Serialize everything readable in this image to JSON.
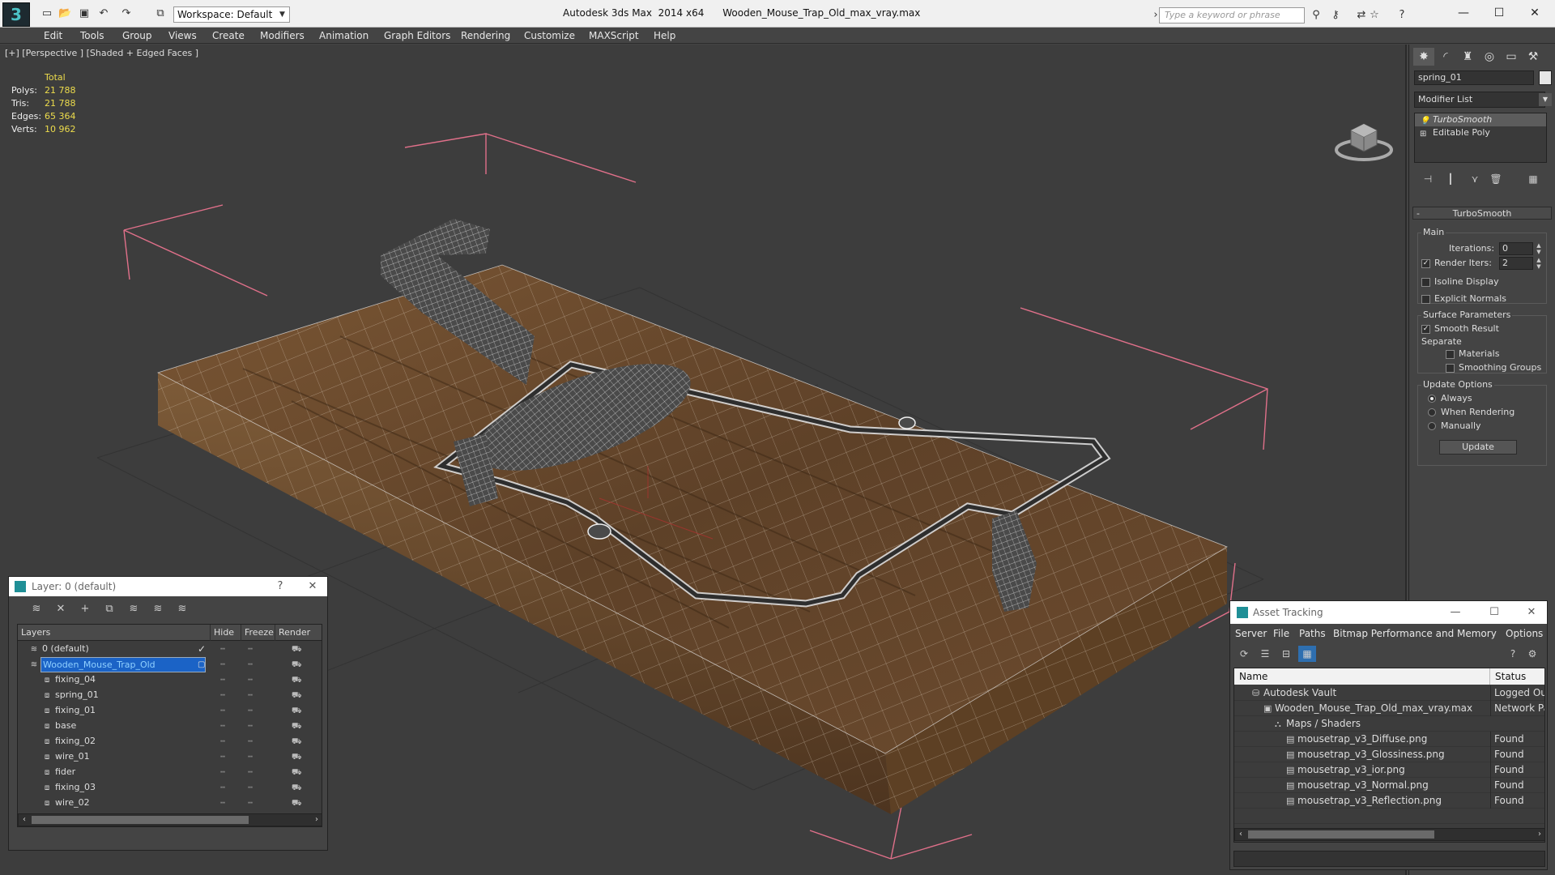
{
  "titlebar": {
    "workspace": "Workspace: Default",
    "title": "Autodesk 3ds Max  2014 x64      Wooden_Mouse_Trap_Old_max_vray.max",
    "search_placeholder": "Type a keyword or phrase"
  },
  "menu": [
    "Edit",
    "Tools",
    "Group",
    "Views",
    "Create",
    "Modifiers",
    "Animation",
    "Graph Editors",
    "Rendering",
    "Customize",
    "MAXScript",
    "Help"
  ],
  "viewport": {
    "label": "[+] [Perspective ] [Shaded + Edged Faces ]",
    "stats": {
      "total_label": "Total",
      "rows": [
        {
          "name": "Polys:",
          "value": "21 788"
        },
        {
          "name": "Tris:",
          "value": "21 788"
        },
        {
          "name": "Edges:",
          "value": "65 364"
        },
        {
          "name": "Verts:",
          "value": "10 962"
        }
      ]
    }
  },
  "command_panel": {
    "object_name": "spring_01",
    "modifier_list": "Modifier List",
    "stack": [
      {
        "label": "TurboSmooth",
        "selected": true
      },
      {
        "label": "Editable Poly",
        "selected": false
      }
    ],
    "rollout": {
      "title": "TurboSmooth",
      "main": {
        "title": "Main",
        "iterations_label": "Iterations:",
        "iterations": "0",
        "render_iters_label": "Render Iters:",
        "render_iters": "2",
        "isoline": "Isoline Display",
        "explicit_normals": "Explicit Normals"
      },
      "surface": {
        "title": "Surface Parameters",
        "smooth_result": "Smooth Result",
        "separate": "Separate",
        "materials": "Materials",
        "smoothing_groups": "Smoothing Groups"
      },
      "update": {
        "title": "Update Options",
        "always": "Always",
        "when_rendering": "When Rendering",
        "manually": "Manually",
        "button": "Update"
      }
    }
  },
  "layer_panel": {
    "title": "Layer: 0 (default)",
    "columns": {
      "layers": "Layers",
      "hide": "Hide",
      "freeze": "Freeze",
      "render": "Render"
    },
    "rows": [
      {
        "name": "0 (default)",
        "level": 0,
        "active": true
      },
      {
        "name": "Wooden_Mouse_Trap_Old",
        "level": 0,
        "selected": true
      },
      {
        "name": "fixing_04",
        "level": 1
      },
      {
        "name": "spring_01",
        "level": 1
      },
      {
        "name": "fixing_01",
        "level": 1
      },
      {
        "name": "base",
        "level": 1
      },
      {
        "name": "fixing_02",
        "level": 1
      },
      {
        "name": "wire_01",
        "level": 1
      },
      {
        "name": "fider",
        "level": 1
      },
      {
        "name": "fixing_03",
        "level": 1
      },
      {
        "name": "wire_02",
        "level": 1
      },
      {
        "name": "Wooden_Mouse_Trap_Old",
        "level": 1
      }
    ]
  },
  "asset_panel": {
    "title": "Asset Tracking",
    "menu": [
      "Server",
      "File",
      "Paths",
      "Bitmap Performance and Memory",
      "Options"
    ],
    "columns": {
      "name": "Name",
      "status": "Status"
    },
    "rows": [
      {
        "name": "Autodesk Vault",
        "level": 0,
        "status": "Logged Out"
      },
      {
        "name": "Wooden_Mouse_Trap_Old_max_vray.max",
        "level": 1,
        "status": "Network Pa"
      },
      {
        "name": "Maps / Shaders",
        "level": 2,
        "status": ""
      },
      {
        "name": "mousetrap_v3_Diffuse.png",
        "level": 3,
        "status": "Found"
      },
      {
        "name": "mousetrap_v3_Glossiness.png",
        "level": 3,
        "status": "Found"
      },
      {
        "name": "mousetrap_v3_ior.png",
        "level": 3,
        "status": "Found"
      },
      {
        "name": "mousetrap_v3_Normal.png",
        "level": 3,
        "status": "Found"
      },
      {
        "name": "mousetrap_v3_Reflection.png",
        "level": 3,
        "status": "Found"
      }
    ]
  },
  "colors": {
    "viewport_bg": "#3d3d3d",
    "stat_value": "#eddc4c",
    "selection": "#1b63c6",
    "wood": "#6b4a2a"
  }
}
